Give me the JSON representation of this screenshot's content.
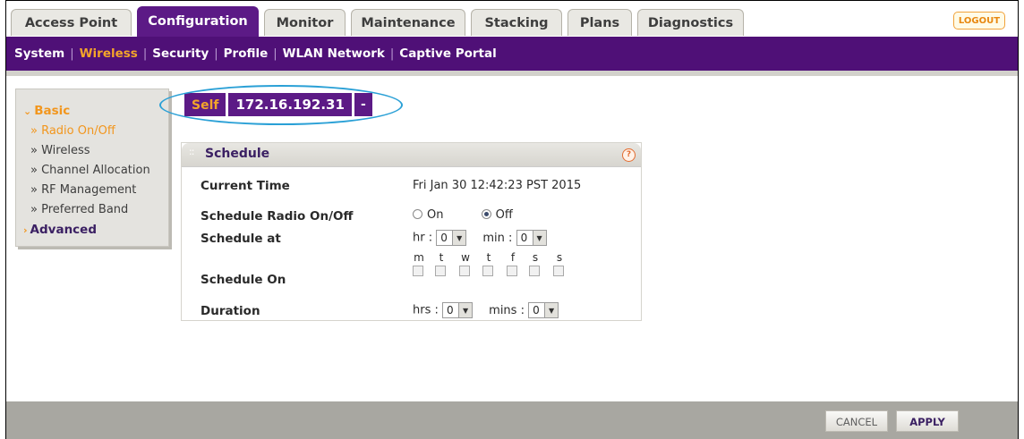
{
  "tabs": [
    {
      "label": "Access Point",
      "active": false
    },
    {
      "label": "Configuration",
      "active": true
    },
    {
      "label": "Monitor",
      "active": false
    },
    {
      "label": "Maintenance",
      "active": false
    },
    {
      "label": "Stacking",
      "active": false
    },
    {
      "label": "Plans",
      "active": false
    },
    {
      "label": "Diagnostics",
      "active": false
    }
  ],
  "logout_label": "LOGOUT",
  "subnav": [
    "System",
    "Wireless",
    "Security",
    "Profile",
    "WLAN Network",
    "Captive Portal"
  ],
  "subnav_active": "Wireless",
  "sidenav": {
    "basic_label": "Basic",
    "items": [
      "Radio On/Off",
      "Wireless",
      "Channel Allocation",
      "RF Management",
      "Preferred Band"
    ],
    "active_item": "Radio On/Off",
    "advanced_label": "Advanced"
  },
  "ap_selector": {
    "self": "Self",
    "ip": "172.16.192.31",
    "dash": "-"
  },
  "panel": {
    "title": "Schedule",
    "current_time_label": "Current Time",
    "current_time_value": "Fri Jan 30 12:42:23 PST 2015",
    "radio_label": "Schedule Radio On/Off",
    "radio_on": "On",
    "radio_off": "Off",
    "radio_selected": "Off",
    "schedule_at_label": "Schedule at",
    "hr_label": "hr :",
    "hr_value": "0",
    "min_label": "min :",
    "min_value": "0",
    "schedule_on_label": "Schedule On",
    "days": [
      "m",
      "t",
      "w",
      "t",
      "f",
      "s",
      "s"
    ],
    "duration_label": "Duration",
    "hrs_label": "hrs :",
    "hrs_value": "0",
    "mins_label": "mins :",
    "mins_value": "0"
  },
  "buttons": {
    "cancel": "CANCEL",
    "apply": "APPLY"
  },
  "colors": {
    "brand_purple": "#4f1077",
    "accent_orange": "#f2961d",
    "highlight": "#2aa0d6"
  }
}
